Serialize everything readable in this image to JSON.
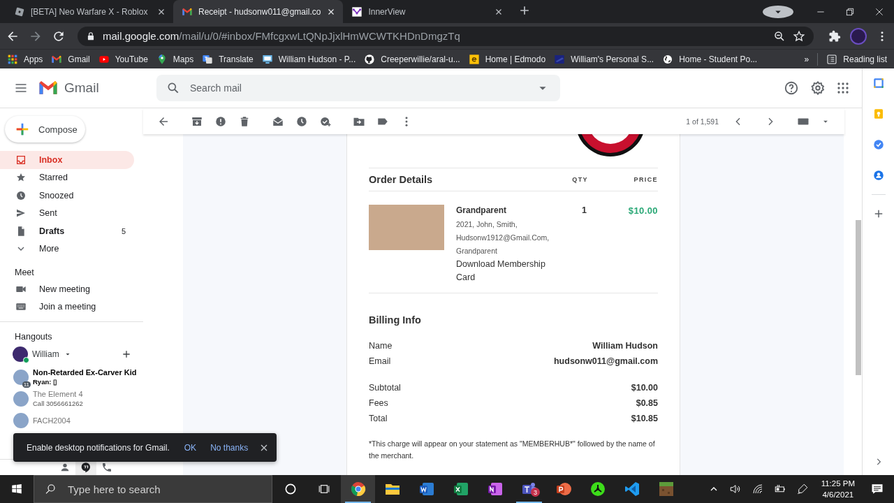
{
  "browser": {
    "tabs": [
      {
        "title": "[BETA] Neo Warfare X - Roblox",
        "selected": false
      },
      {
        "title": "Receipt - hudsonw011@gmail.co",
        "selected": true
      },
      {
        "title": "InnerView",
        "selected": false
      }
    ],
    "url": {
      "host": "mail.google.com",
      "path": "/mail/u/0/#inbox/FMfcgxwLtQNpJjxlHmWCWTKHDnDmgzTq"
    },
    "bookmarks": [
      "Apps",
      "Gmail",
      "YouTube",
      "Maps",
      "Translate",
      "William Hudson - P...",
      "Creeperwillie/aral-u...",
      "Home | Edmodo",
      "William's Personal S...",
      "Home - Student Po..."
    ],
    "more": "»",
    "reading_list": "Reading list"
  },
  "gmail": {
    "product": "Gmail",
    "search_placeholder": "Search mail"
  },
  "sidebar": {
    "compose": "Compose",
    "folders": [
      {
        "label": "Inbox",
        "selected": true
      },
      {
        "label": "Starred",
        "selected": false
      },
      {
        "label": "Snoozed",
        "selected": false
      },
      {
        "label": "Sent",
        "selected": false
      },
      {
        "label": "Drafts",
        "selected": false,
        "count": "5"
      },
      {
        "label": "More",
        "selected": false
      }
    ],
    "meet": {
      "title": "Meet",
      "items": [
        "New meeting",
        "Join a meeting"
      ]
    },
    "hangouts": {
      "title": "Hangouts",
      "user": "William",
      "online": true,
      "conversations": [
        {
          "name": "Non-Retarded Ex-Carver Kid",
          "message": "Ryan: ▯",
          "unread": true,
          "badge": "11"
        },
        {
          "name": "The Element 4",
          "message": "Call 3056661262",
          "unread": false
        },
        {
          "name": "FACH2004",
          "unread": false
        }
      ]
    },
    "bottom_tabs": [
      {
        "selected": false
      },
      {
        "selected": true
      },
      {
        "selected": false
      }
    ]
  },
  "toolbar": {
    "count": "1 of 1,591"
  },
  "email": {
    "order_title": "Order Details",
    "qty_header": "QTY",
    "price_header": "PRICE",
    "item": {
      "name": "Grandparent",
      "details": [
        "2021, John, Smith,",
        "Hudsonw1912@Gmail.Com,",
        "Grandparent"
      ],
      "link": "Download Membership Card",
      "qty": "1",
      "price": "$10.00"
    },
    "billing_title": "Billing Info",
    "contact": [
      {
        "label": "Name",
        "value": "William Hudson"
      },
      {
        "label": "Email",
        "value": "hudsonw011@gmail.com"
      }
    ],
    "totals": [
      {
        "label": "Subtotal",
        "value": "$10.00"
      },
      {
        "label": "Fees",
        "value": "$0.85"
      },
      {
        "label": "Total",
        "value": "$10.85"
      }
    ],
    "footnote": "*This charge will appear on your statement as \"MEMBERHUB*\" followed by the name of the merchant."
  },
  "toast": {
    "message": "Enable desktop notifications for Gmail.",
    "actions": [
      "OK",
      "No thanks"
    ]
  },
  "taskbar": {
    "search_placeholder": "Type here to search",
    "apps": [
      {
        "running": true,
        "selected": true
      },
      {
        "running": false,
        "selected": false
      },
      {
        "running": false,
        "selected": false
      },
      {
        "running": false,
        "selected": false
      },
      {
        "running": false,
        "selected": false
      },
      {
        "running": true,
        "selected": false,
        "badge": "3"
      },
      {
        "running": false,
        "selected": false
      },
      {
        "running": false,
        "selected": false
      },
      {
        "running": false,
        "selected": false
      },
      {
        "running": false,
        "selected": false
      }
    ],
    "time": "11:25 PM",
    "date": "4/6/2021"
  }
}
